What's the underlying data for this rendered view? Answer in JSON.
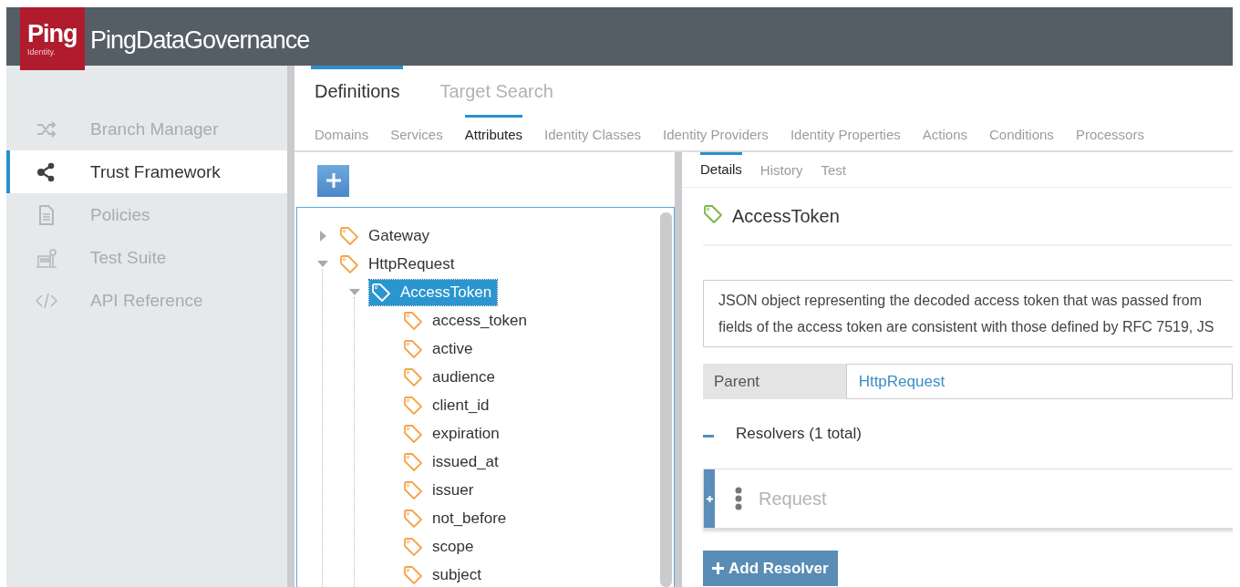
{
  "header": {
    "logo": {
      "word": "Ping",
      "sub": "Identity."
    },
    "title": "PingDataGovernance"
  },
  "sidebar": {
    "items": [
      {
        "label": "Branch Manager",
        "selected": false
      },
      {
        "label": "Trust Framework",
        "selected": true
      },
      {
        "label": "Policies",
        "selected": false
      },
      {
        "label": "Test Suite",
        "selected": false
      },
      {
        "label": "API Reference",
        "selected": false
      }
    ]
  },
  "tabs": [
    {
      "label": "Definitions",
      "selected": true
    },
    {
      "label": "Target Search",
      "selected": false
    }
  ],
  "subtabs": [
    {
      "label": "Domains",
      "selected": false
    },
    {
      "label": "Services",
      "selected": false
    },
    {
      "label": "Attributes",
      "selected": true
    },
    {
      "label": "Identity Classes",
      "selected": false
    },
    {
      "label": "Identity Providers",
      "selected": false
    },
    {
      "label": "Identity Properties",
      "selected": false
    },
    {
      "label": "Actions",
      "selected": false
    },
    {
      "label": "Conditions",
      "selected": false
    },
    {
      "label": "Processors",
      "selected": false
    }
  ],
  "tree": [
    {
      "label": "Gateway",
      "expanded": false,
      "selected": false
    },
    {
      "label": "HttpRequest",
      "expanded": true,
      "selected": false,
      "children": [
        {
          "label": "AccessToken",
          "expanded": true,
          "selected": true,
          "children": [
            {
              "label": "access_token",
              "selected": false
            },
            {
              "label": "active",
              "selected": false
            },
            {
              "label": "audience",
              "selected": false
            },
            {
              "label": "client_id",
              "selected": false
            },
            {
              "label": "expiration",
              "selected": false
            },
            {
              "label": "issued_at",
              "selected": false
            },
            {
              "label": "issuer",
              "selected": false
            },
            {
              "label": "not_before",
              "selected": false
            },
            {
              "label": "scope",
              "selected": false
            },
            {
              "label": "subject",
              "selected": false
            }
          ]
        }
      ]
    }
  ],
  "details": {
    "tabs": [
      {
        "label": "Details",
        "selected": true
      },
      {
        "label": "History",
        "selected": false
      },
      {
        "label": "Test",
        "selected": false
      }
    ],
    "title": "AccessToken",
    "description": [
      "JSON object representing the decoded access token that was passed from",
      "fields of the access token are consistent with those defined by RFC 7519, JS"
    ],
    "parent": {
      "label": "Parent",
      "value": "HttpRequest"
    },
    "resolvers": {
      "label": "Resolvers (1 total)",
      "expanded": true,
      "items": [
        {
          "placeholder": "Request"
        }
      ]
    },
    "add_button": "Add Resolver"
  }
}
